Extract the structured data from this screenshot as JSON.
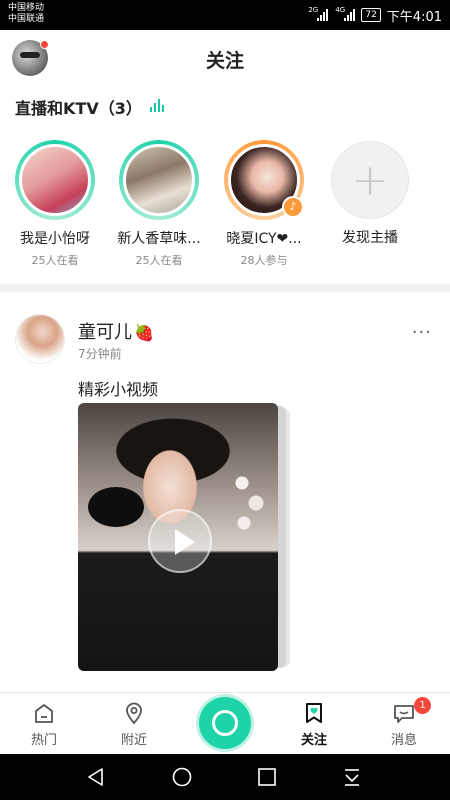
{
  "status_bar": {
    "carrier_1": "中国移动",
    "carrier_2": "中国联通",
    "net_1": "2G",
    "net_2": "4G",
    "battery": "72",
    "time": "下午4:01"
  },
  "header": {
    "title": "关注"
  },
  "live_section": {
    "title": "直播和KTV（3）",
    "items": [
      {
        "name": "我是小怡呀",
        "count": "25人在看",
        "ring": "green"
      },
      {
        "name": "新人香草味...",
        "count": "25人在看",
        "ring": "green"
      },
      {
        "name": "晓夏ICY❤...",
        "count": "28人参与",
        "ring": "orange"
      }
    ],
    "discover_label": "发现主播"
  },
  "post": {
    "user": "童可儿",
    "user_emoji": "🍓",
    "time": "7分钟前",
    "more": "···",
    "text": "精彩小视频"
  },
  "tabbar": {
    "tabs": [
      {
        "label": "热门",
        "icon": "home-icon"
      },
      {
        "label": "附近",
        "icon": "location-pin-icon"
      },
      {
        "label": "关注",
        "icon": "bookmark-heart-icon",
        "active": true
      },
      {
        "label": "消息",
        "icon": "chat-bubble-icon",
        "badge": "1"
      }
    ]
  },
  "colors": {
    "accent": "#1fd3a8",
    "badge_red": "#f5463c",
    "ktv_orange": "#ff9a3c"
  }
}
